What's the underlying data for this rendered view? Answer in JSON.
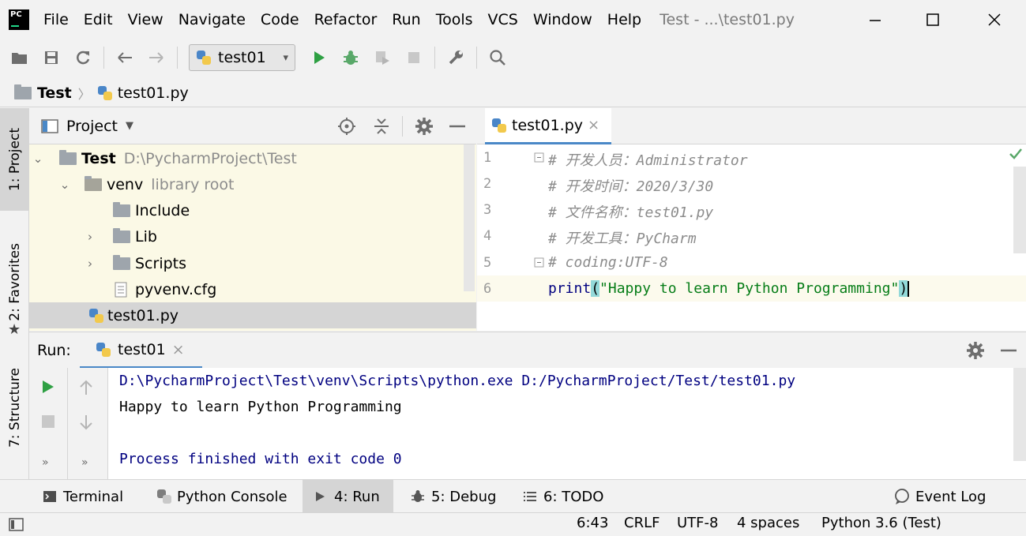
{
  "app": {
    "logo_text": "PC",
    "title": "Test - ...\\test01.py"
  },
  "menu": [
    "File",
    "Edit",
    "View",
    "Navigate",
    "Code",
    "Refactor",
    "Run",
    "Tools",
    "VCS",
    "Window",
    "Help"
  ],
  "toolbar": {
    "run_config": "test01"
  },
  "breadcrumb": {
    "project": "Test",
    "file": "test01.py"
  },
  "left_strip": {
    "project_tab": "1: Project",
    "favorites_tab": "2: Favorites",
    "structure_tab": "7: Structure"
  },
  "project_panel": {
    "title": "Project",
    "tree": [
      {
        "name": "Test",
        "hint": "D:\\PycharmProject\\Test"
      },
      {
        "name": "venv",
        "hint": "library root"
      },
      {
        "name": "Include",
        "hint": ""
      },
      {
        "name": "Lib",
        "hint": ""
      },
      {
        "name": "Scripts",
        "hint": ""
      },
      {
        "name": "pyvenv.cfg",
        "hint": ""
      },
      {
        "name": "test01.py",
        "hint": ""
      }
    ]
  },
  "editor": {
    "tab": "test01.py",
    "line_numbers": [
      "1",
      "2",
      "3",
      "4",
      "5",
      "6"
    ],
    "lines": [
      "# 开发人员：Administrator",
      "# 开发时间：2020/3/30",
      "# 文件名称：test01.py",
      "# 开发工具：PyCharm",
      "# coding:UTF-8"
    ],
    "print_kw": "print",
    "open_paren": "(",
    "string": "\"Happy to learn Python Programming\"",
    "close_paren": ")"
  },
  "run_panel": {
    "label": "Run:",
    "tab": "test01",
    "output": [
      "D:\\PycharmProject\\Test\\venv\\Scripts\\python.exe D:/PycharmProject/Test/test01.py",
      "Happy to learn Python Programming",
      "",
      "Process finished with exit code 0"
    ]
  },
  "bottom_tabs": {
    "terminal": "Terminal",
    "python_console": "Python Console",
    "run": "4: Run",
    "debug": "5: Debug",
    "todo": "6: TODO",
    "event_log": "Event Log"
  },
  "status": {
    "position": "6:43",
    "line_sep": "CRLF",
    "encoding": "UTF-8",
    "indent": "4 spaces",
    "interpreter": "Python 3.6 (Test)"
  },
  "colors": {
    "accent": "#4a88c7",
    "run_green": "#2ea043",
    "debug_green": "#59a869",
    "string_green": "#067d17",
    "keyword_navy": "#000080",
    "tree_bg": "#fbf9e6"
  }
}
